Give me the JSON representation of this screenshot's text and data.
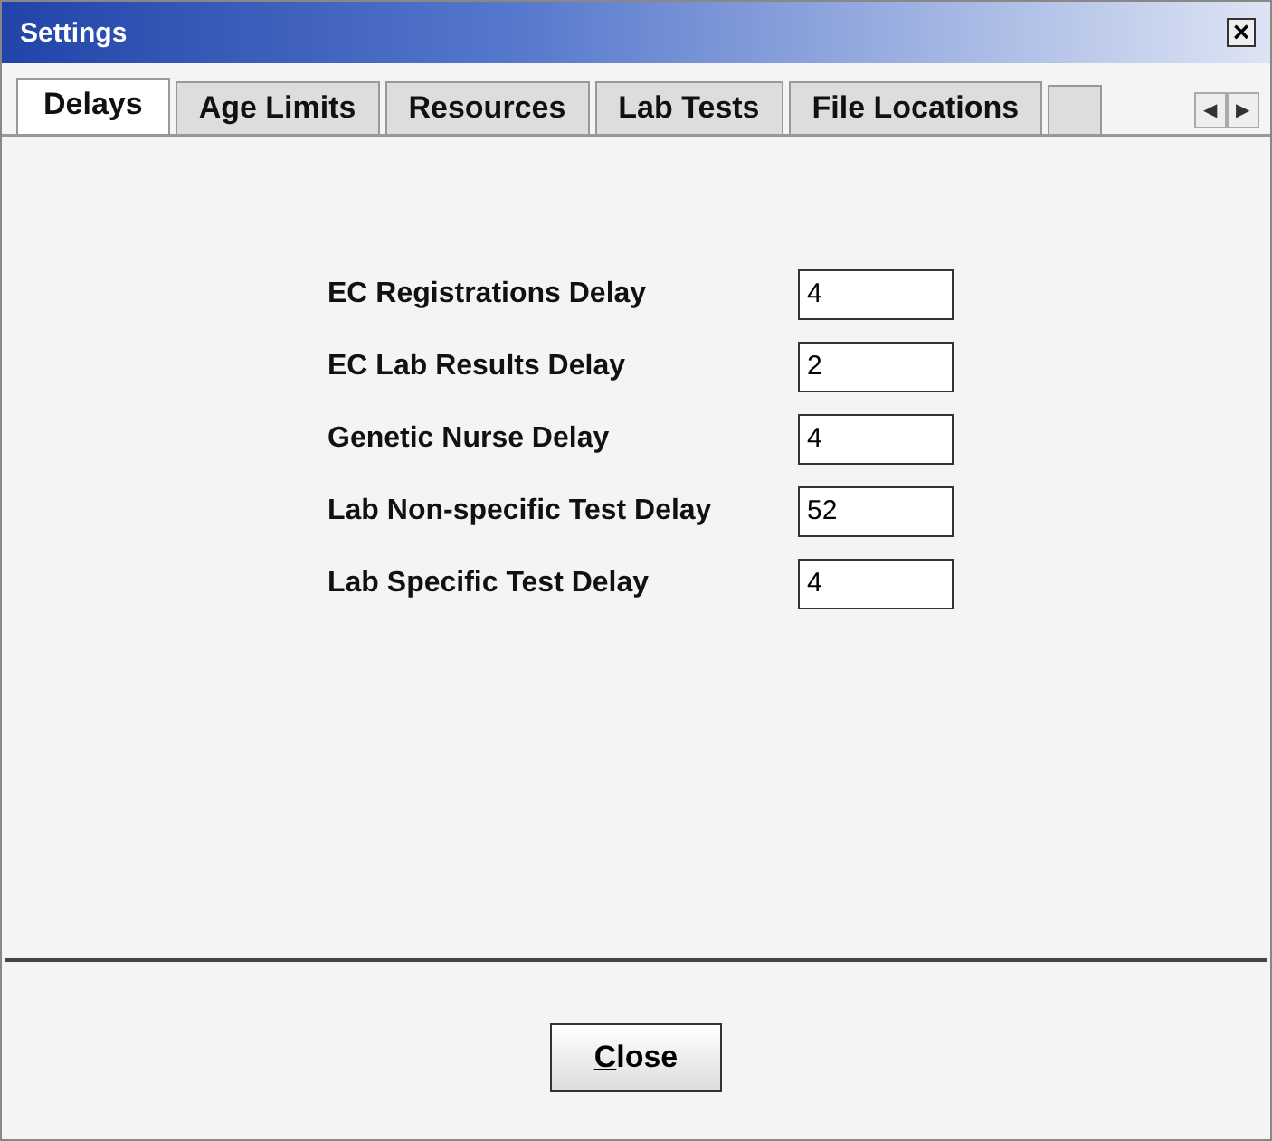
{
  "window": {
    "title": "Settings",
    "close": "×"
  },
  "tabs": [
    {
      "label": "Delays",
      "selected": true
    },
    {
      "label": "Age Limits",
      "selected": false
    },
    {
      "label": "Resources",
      "selected": false
    },
    {
      "label": "Lab Tests",
      "selected": false
    },
    {
      "label": "File Locations",
      "selected": false
    }
  ],
  "tab_scroll": [
    "◀",
    "▶"
  ],
  "fields": [
    {
      "label": "EC Registrations Delay",
      "value": "4"
    },
    {
      "label": "EC Lab Results Delay",
      "value": "2"
    },
    {
      "label": "Genetic Nurse Delay",
      "value": "4"
    },
    {
      "label": "Lab Non-specific Test Delay",
      "value": "52"
    },
    {
      "label": "Lab Specific Test Delay",
      "value": "4"
    }
  ],
  "close_button": {
    "label": "Close",
    "mnemonic_underlined": true
  }
}
